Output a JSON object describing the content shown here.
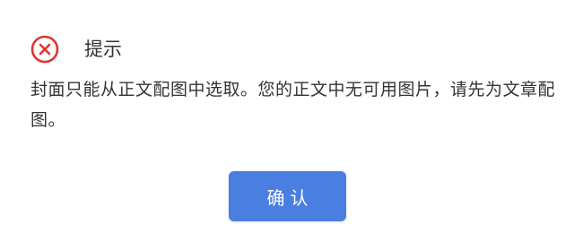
{
  "dialog": {
    "title": "提示",
    "icon": "error-circle-x-icon",
    "message": "封面只能从正文配图中选取。您的正文中无可用图片，请先为文章配图。",
    "confirm_label": "确认",
    "colors": {
      "error_icon": "#e0342f",
      "button": "#4a7ee0",
      "text": "#333333"
    }
  }
}
